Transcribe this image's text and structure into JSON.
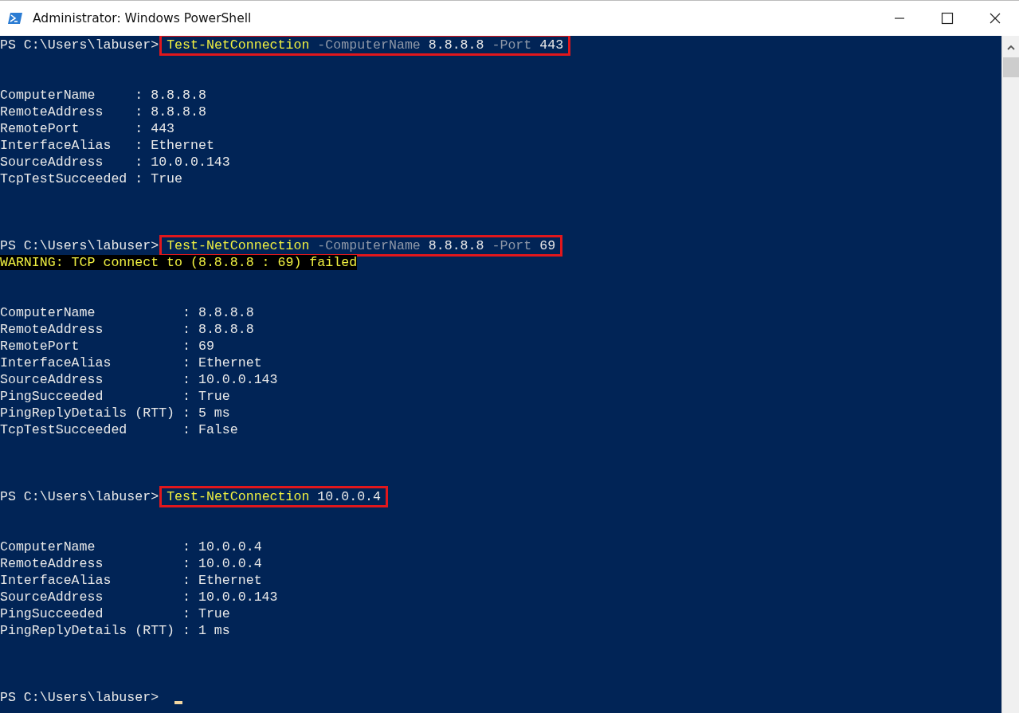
{
  "window": {
    "title": "Administrator: Windows PowerShell"
  },
  "lines": [
    {
      "kind": "command",
      "prompt": "PS C:\\Users\\labuser>",
      "boxed": true,
      "cursor": false,
      "tokens": [
        {
          "kind": "cmdlet",
          "text": "Test-NetConnection"
        },
        {
          "kind": "param",
          "text": "-ComputerName"
        },
        {
          "kind": "arg",
          "text": "8.8.8.8"
        },
        {
          "kind": "param",
          "text": "-Port"
        },
        {
          "kind": "arg",
          "text": "443"
        }
      ]
    },
    {
      "kind": "blank"
    },
    {
      "kind": "blank"
    },
    {
      "kind": "output",
      "text": "ComputerName     : 8.8.8.8"
    },
    {
      "kind": "output",
      "text": "RemoteAddress    : 8.8.8.8"
    },
    {
      "kind": "output",
      "text": "RemotePort       : 443"
    },
    {
      "kind": "output",
      "text": "InterfaceAlias   : Ethernet"
    },
    {
      "kind": "output",
      "text": "SourceAddress    : 10.0.0.143"
    },
    {
      "kind": "output",
      "text": "TcpTestSucceeded : True"
    },
    {
      "kind": "blank"
    },
    {
      "kind": "blank"
    },
    {
      "kind": "blank"
    },
    {
      "kind": "command",
      "prompt": "PS C:\\Users\\labuser>",
      "boxed": true,
      "cursor": false,
      "tokens": [
        {
          "kind": "cmdlet",
          "text": "Test-NetConnection"
        },
        {
          "kind": "param",
          "text": "-ComputerName"
        },
        {
          "kind": "arg",
          "text": "8.8.8.8"
        },
        {
          "kind": "param",
          "text": "-Port"
        },
        {
          "kind": "arg",
          "text": "69"
        }
      ]
    },
    {
      "kind": "warning",
      "text": "WARNING: TCP connect to (8.8.8.8 : 69) failed"
    },
    {
      "kind": "blank"
    },
    {
      "kind": "blank"
    },
    {
      "kind": "output",
      "text": "ComputerName           : 8.8.8.8"
    },
    {
      "kind": "output",
      "text": "RemoteAddress          : 8.8.8.8"
    },
    {
      "kind": "output",
      "text": "RemotePort             : 69"
    },
    {
      "kind": "output",
      "text": "InterfaceAlias         : Ethernet"
    },
    {
      "kind": "output",
      "text": "SourceAddress          : 10.0.0.143"
    },
    {
      "kind": "output",
      "text": "PingSucceeded          : True"
    },
    {
      "kind": "output",
      "text": "PingReplyDetails (RTT) : 5 ms"
    },
    {
      "kind": "output",
      "text": "TcpTestSucceeded       : False"
    },
    {
      "kind": "blank"
    },
    {
      "kind": "blank"
    },
    {
      "kind": "blank"
    },
    {
      "kind": "command",
      "prompt": "PS C:\\Users\\labuser>",
      "boxed": true,
      "cursor": false,
      "tokens": [
        {
          "kind": "cmdlet",
          "text": "Test-NetConnection"
        },
        {
          "kind": "arg",
          "text": "10.0.0.4"
        }
      ]
    },
    {
      "kind": "blank"
    },
    {
      "kind": "blank"
    },
    {
      "kind": "output",
      "text": "ComputerName           : 10.0.0.4"
    },
    {
      "kind": "output",
      "text": "RemoteAddress          : 10.0.0.4"
    },
    {
      "kind": "output",
      "text": "InterfaceAlias         : Ethernet"
    },
    {
      "kind": "output",
      "text": "SourceAddress          : 10.0.0.143"
    },
    {
      "kind": "output",
      "text": "PingSucceeded          : True"
    },
    {
      "kind": "output",
      "text": "PingReplyDetails (RTT) : 1 ms"
    },
    {
      "kind": "blank"
    },
    {
      "kind": "blank"
    },
    {
      "kind": "blank"
    },
    {
      "kind": "command",
      "prompt": "PS C:\\Users\\labuser>",
      "boxed": false,
      "cursor": true
    }
  ]
}
